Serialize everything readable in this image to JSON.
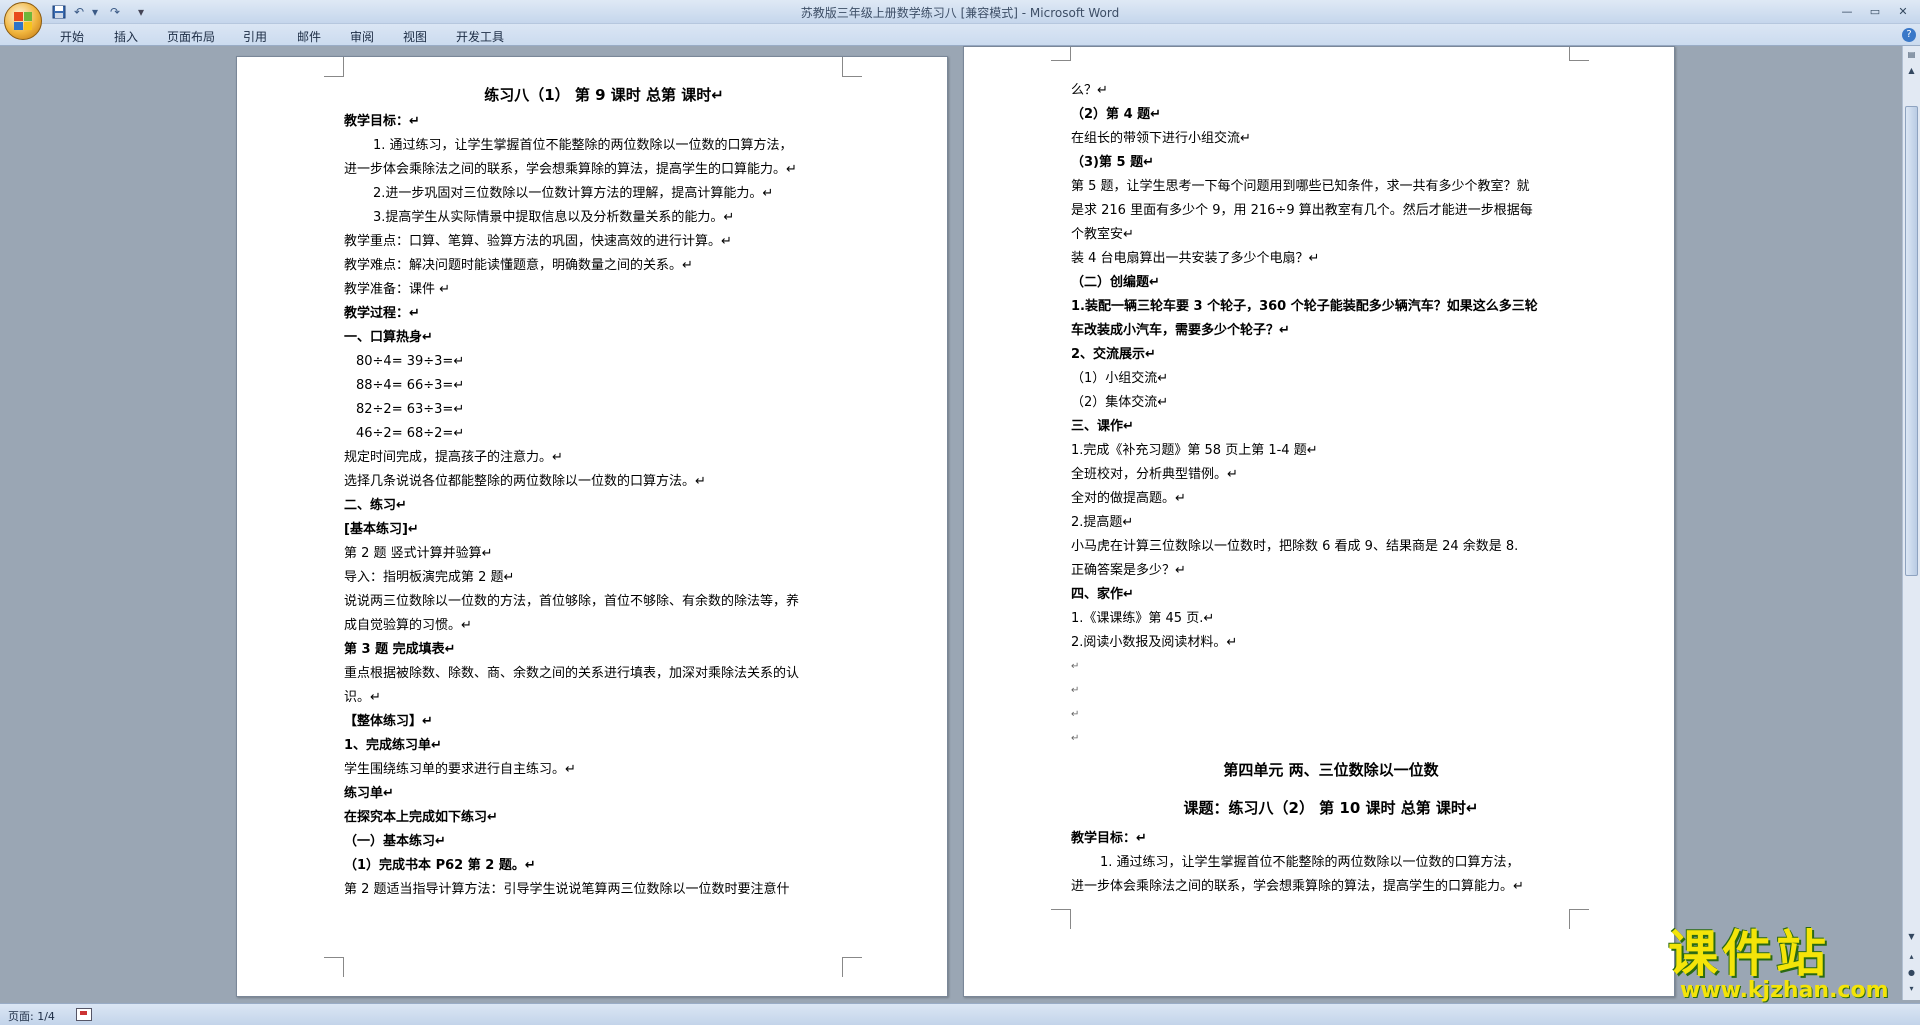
{
  "window": {
    "title": "苏教版三年级上册数学练习八 [兼容模式] - Microsoft Word"
  },
  "quick_access": {
    "undo": "↶",
    "redo": "↷",
    "customize": "▾"
  },
  "window_controls": {
    "minimize": "—",
    "restore": "▭",
    "close": "✕"
  },
  "menu": [
    "开始",
    "插入",
    "页面布局",
    "引用",
    "邮件",
    "审阅",
    "视图",
    "开发工具"
  ],
  "status": {
    "page_count": "页面: 1/4"
  },
  "watermark": {
    "main": "课件站",
    "url": "www.kjzhan.com"
  },
  "left_page": {
    "lines": [
      "练习八（1）  第 9 课时  总第  课时↵",
      "教学目标：↵",
      "1. 通过练习，让学生掌握首位不能整除的两位数除以一位数的口算方法，",
      "进一步体会乘除法之间的联系，学会想乘算除的算法，提高学生的口算能力。↵",
      "2.进一步巩固对三位数除以一位数计算方法的理解，提高计算能力。↵",
      "3.提高学生从实际情景中提取信息以及分析数量关系的能力。↵",
      "教学重点：口算、笔算、验算方法的巩固，快速高效的进行计算。↵",
      "教学难点：解决问题时能读懂题意，明确数量之间的关系。↵",
      "教学准备：课件  ↵",
      "教学过程：↵",
      "一、口算热身↵",
      "80÷4=   39÷3=↵",
      "88÷4=   66÷3=↵",
      "82÷2=   63÷3=↵",
      "46÷2=   68÷2=↵",
      "规定时间完成，提高孩子的注意力。↵",
      "选择几条说说各位都能整除的两位数除以一位数的口算方法。↵",
      "二、练习↵",
      "[基本练习]↵",
      "第 2 题  竖式计算并验算↵",
      "导入：指明板演完成第 2 题↵",
      "说说两三位数除以一位数的方法，首位够除，首位不够除、有余数的除法等，养",
      "成自觉验算的习惯。↵",
      "第 3 题  完成填表↵",
      "重点根据被除数、除数、商、余数之间的关系进行填表，加深对乘除法关系的认",
      "识。↵",
      "【整体练习】↵",
      "1、完成练习单↵",
      "学生围绕练习单的要求进行自主练习。↵",
      "练习单↵",
      "在探究本上完成如下练习↵",
      "（一）基本练习↵",
      "（1）完成书本 P62 第 2 题。↵",
      "第 2 题适当指导计算方法：引导学生说说笔算两三位数除以一位数时要注意什"
    ]
  },
  "right_page": {
    "lines": [
      "么？↵",
      "（2）第 4 题↵",
      " 在组长的带领下进行小组交流↵",
      "（3)第 5 题↵",
      "第 5 题，让学生思考一下每个问题用到哪些已知条件，求一共有多少个教室？就",
      "是求 216 里面有多少个 9，用 216÷9 算出教室有几个。然后才能进一步根据每",
      "  个教室安↵",
      "装 4 台电扇算出一共安装了多少个电扇？↵",
      "（二）创编题↵",
      "1.装配一辆三轮车要 3 个轮子，360 个轮子能装配多少辆汽车？如果这么多三轮",
      "车改装成小汽车，需要多少个轮子？↵",
      "2、交流展示↵",
      "（1）小组交流↵",
      "（2）集体交流↵",
      "三、课作↵",
      "1.完成《补充习题》第 58 页上第 1-4 题↵",
      "全班校对，分析典型错例。↵",
      "全对的做提高题。↵",
      "2.提高题↵",
      " 小马虎在计算三位数除以一位数时，把除数 6 看成 9、结果商是 24 余数是 8.",
      "正确答案是多少？↵",
      "四、家作↵",
      "1.《课课练》第 45 页.↵",
      "2.阅读小数报及阅读材料。↵",
      "↵",
      "↵",
      "↵",
      "↵",
      "第四单元  两、三位数除以一位数",
      "课题：练习八（2）  第 10 课时  总第  课时↵",
      "教学目标：↵",
      "1. 通过练习，让学生掌握首位不能整除的两位数除以一位数的口算方法，",
      "进一步体会乘除法之间的联系，学会想乘算除的算法，提高学生的口算能力。↵"
    ]
  }
}
